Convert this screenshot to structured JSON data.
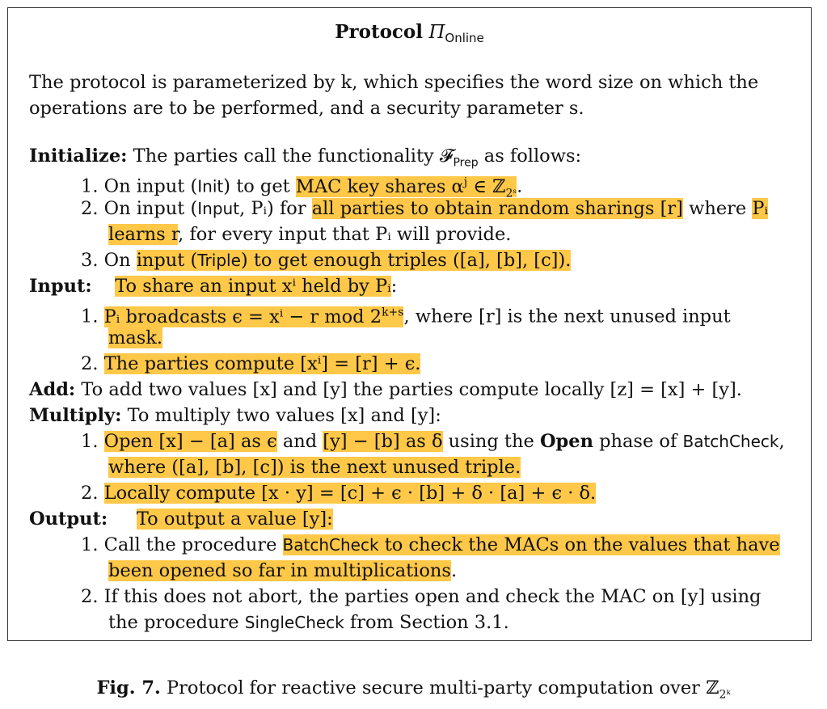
{
  "title": {
    "bold": "Protocol",
    "pi": "Π",
    "sub": "Online"
  },
  "intro": [
    "The protocol is parameterized by k, which specifies the word size on which the",
    "operations are to be performed, and a security parameter s."
  ],
  "initialize": {
    "label": "Initialize:",
    "text": " The parties call the functionality 𝓕",
    "func_sub": "Prep",
    "text2": " as follows:",
    "items": [
      {
        "num": "1.",
        "pre": "On input (",
        "sf": "Init",
        "mid": ") to get ",
        "hl": "MAC key shares α",
        "hl_sup": "j",
        "hl_post": " ∈ ℤ",
        "hl_sub": "2ˢ",
        "post": "."
      },
      {
        "num": "2.",
        "pre": "On input (",
        "sf": "Input",
        "mid": ", Pᵢ) for ",
        "hl": "all parties to obtain random sharings [r]",
        "post": " where ",
        "hl3": "Pᵢ"
      },
      {
        "cont": "learns r",
        "post": ", for every input that Pᵢ will provide."
      },
      {
        "num": "3.",
        "pre": "On ",
        "hl_a": "input (",
        "sf": "Triple",
        "hl_b": ") to get enough triples ([a], [b], [c])."
      }
    ]
  },
  "input": {
    "label": "Input:",
    "hl": "To share an input xⁱ held by Pᵢ",
    "post": ":",
    "items": [
      {
        "num": "1.",
        "hl": "Pᵢ broadcasts ϵ = xⁱ − r  mod 2",
        "hl_sup": "k+s",
        "post": ", where [r] is the next unused input"
      },
      {
        "cont": "mask."
      },
      {
        "num": "2.",
        "hl": "The parties compute [xⁱ] = [r] + ϵ."
      }
    ]
  },
  "add": {
    "label": "Add:",
    "text": " To add two values [x] and [y] the parties compute locally [z] = [x] + [y]."
  },
  "multiply": {
    "label": "Multiply:",
    "text": " To multiply two values [x] and [y]:",
    "items": [
      {
        "num": "1.",
        "hl_a": "Open [x] − [a] as ϵ",
        "mid": " and ",
        "hl_b": "[y] − [b] as δ",
        "post": " using the ",
        "bold": "Open",
        "post2": " phase of ",
        "sf": "BatchCheck",
        "post3": ","
      },
      {
        "cont": "where ([a], [b], [c]) is the next unused triple."
      },
      {
        "num": "2.",
        "hl": "Locally compute [x · y] = [c] + ϵ · [b] + δ · [a] + ϵ · δ."
      }
    ]
  },
  "output": {
    "label": "Output:",
    "text": "To output a value [y]:",
    "items": [
      {
        "num": "1.",
        "pre": "Call the procedure ",
        "hl_sf": "BatchCheck",
        "hl": " to check the MACs on the values that have"
      },
      {
        "cont_hl": "been opened so far in multiplications",
        "post": "."
      },
      {
        "num": "2.",
        "text": "If this does not abort, the parties open and check the MAC on [y] using"
      },
      {
        "pre": "the procedure ",
        "sf": "SingleCheck",
        "post": " from Section 3.1."
      }
    ]
  },
  "caption": {
    "bold": "Fig. 7.",
    "text": " Protocol for reactive secure multi-party computation over ℤ",
    "sub": "2ᵏ"
  }
}
